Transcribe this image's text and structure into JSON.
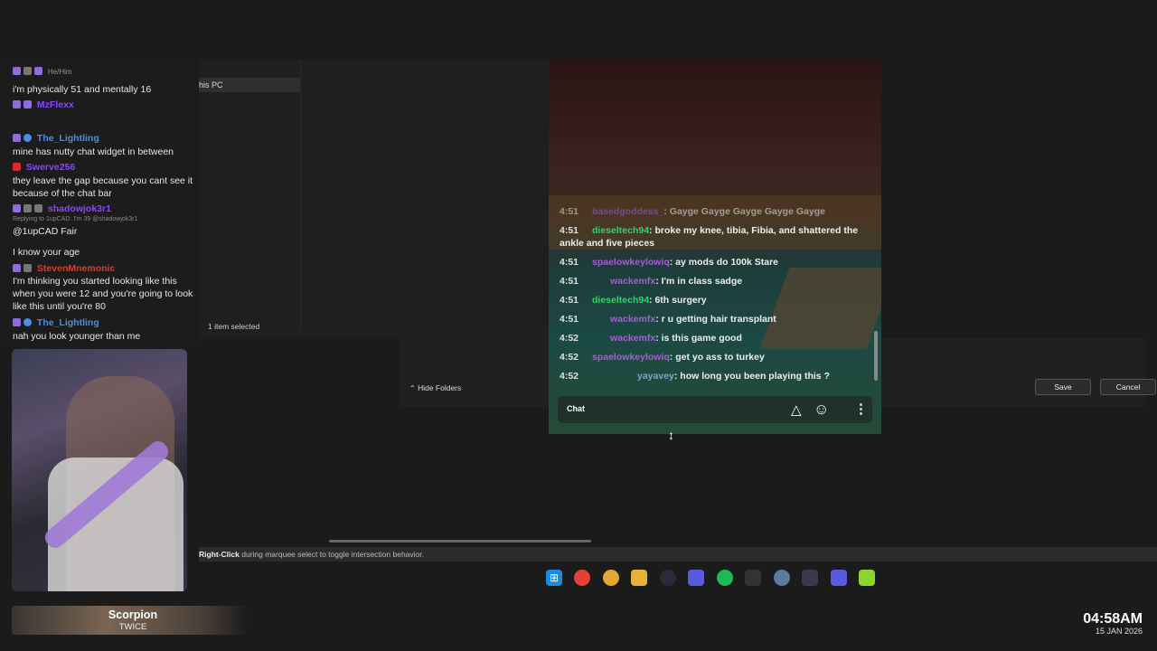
{
  "left_chat": {
    "lines": [
      {
        "user": "He/Him",
        "user_color": "#9a9a9a",
        "text": ""
      },
      {
        "user": "",
        "text": "i'm physically 51 and mentally 16"
      },
      {
        "user": "MzFlexx",
        "user_color": "#8b44ff",
        "text": ""
      },
      {
        "user": "The_Lightling",
        "user_color": "#4a8fe0",
        "text": ""
      },
      {
        "user": "",
        "text": "mine has nutty chat widget in between"
      },
      {
        "user": "Swerve256",
        "user_color": "#8b44ff",
        "text": ""
      },
      {
        "user": "",
        "text": "they leave the gap because you cant see it because of the chat bar"
      },
      {
        "user": "shadowjok3r1",
        "user_color": "#8b44ff",
        "text": ""
      },
      {
        "user": "",
        "text": "Replying to 1upCAD: I'm 39 @shadowjok3r1"
      },
      {
        "user": "",
        "text": "@1upCAD Fair"
      },
      {
        "user": "",
        "text": "I know your age"
      },
      {
        "user": "StevenMnemonic",
        "user_color": "#e23a2a",
        "text": ""
      },
      {
        "user": "",
        "text": "I'm thinking you started looking like this when you were 12 and you're going to look like this until you're 80"
      },
      {
        "user": "The_Lightling",
        "user_color": "#4a8fe0",
        "text": ""
      },
      {
        "user": "",
        "text": "nah you look younger than me"
      }
    ]
  },
  "explorer": {
    "nav_item": "his PC",
    "status": "1 item selected"
  },
  "save_dialog": {
    "hide_folders": "Hide Folders",
    "save_label": "Save",
    "cancel_label": "Cancel"
  },
  "stream_chat": {
    "messages": [
      {
        "time": "4:51",
        "user": "basedgoddess_",
        "user_color": "#a45fd6",
        "text": ": Gayge Gayge Gayge Gayge Gayge"
      },
      {
        "time": "4:51",
        "user": "dieseltech94",
        "user_color": "#2bd66a",
        "text": ": broke my knee, tibia, Fibia, and shattered the ankle and five pieces"
      },
      {
        "time": "4:51",
        "user": "spaelowkeylowiq",
        "user_color": "#a45fd6",
        "text": ": ay mods do 100k Stare"
      },
      {
        "time": "4:51",
        "user": "wackemfx",
        "user_color": "#a45fd6",
        "text": ": I'm in class sadge"
      },
      {
        "time": "4:51",
        "user": "dieseltech94",
        "user_color": "#2bd66a",
        "text": ": 6th surgery"
      },
      {
        "time": "4:51",
        "user": "wackemfx",
        "user_color": "#a45fd6",
        "text": ": r u getting hair transplant"
      },
      {
        "time": "4:52",
        "user": "wackemfx",
        "user_color": "#a45fd6",
        "text": ": is this game good"
      },
      {
        "time": "4:52",
        "user": "spaelowkeylowiq",
        "user_color": "#a45fd6",
        "text": ": get yo ass to turkey"
      },
      {
        "time": "4:52",
        "user": "yayavey",
        "user_color": "#7aa8c8",
        "text": ": how long you been playing this ?"
      }
    ],
    "input_label": "Chat"
  },
  "hint": {
    "bold": "Right-Click",
    "text": " during marquee select to toggle intersection behavior."
  },
  "taskbar": {
    "icons": [
      "windows-icon",
      "chrome-icon",
      "chrome-icon",
      "folder-icon",
      "steam-icon",
      "lightning-icon",
      "spotify-icon",
      "davinci-icon",
      "settings-icon",
      "audio-icon",
      "lightning-icon",
      "app-icon"
    ]
  },
  "now_playing": {
    "title": "Scorpion",
    "artist": "TWICE"
  },
  "clock": {
    "time": "04:58AM",
    "date": "15 JAN 2026"
  }
}
